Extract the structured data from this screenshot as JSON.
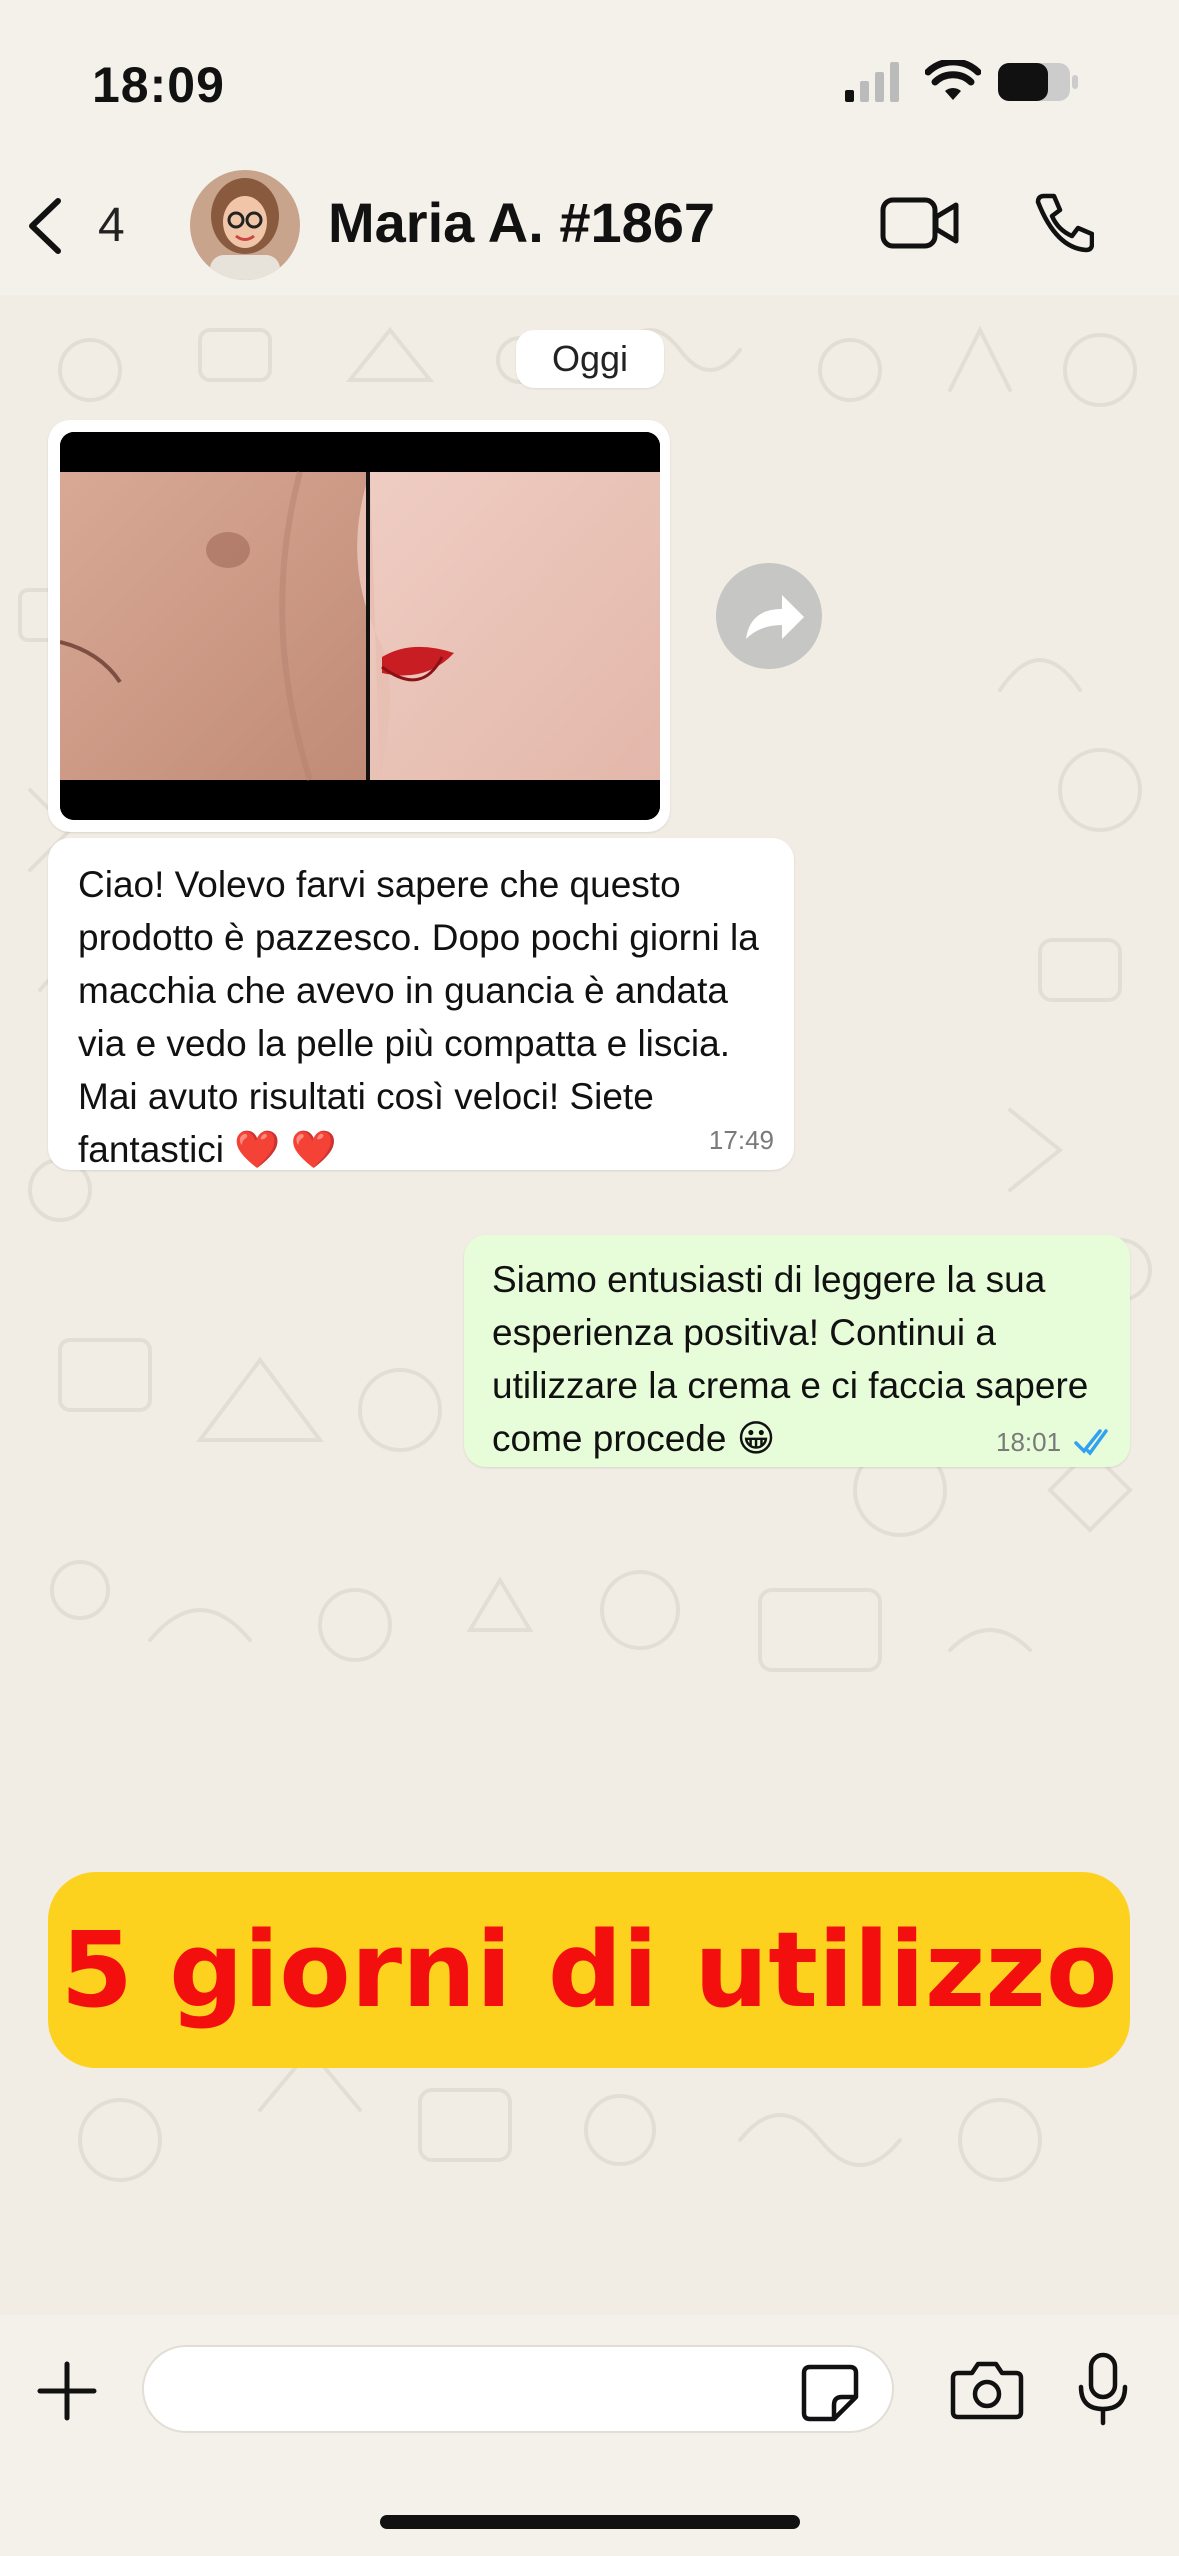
{
  "status_bar": {
    "time": "18:09"
  },
  "header": {
    "back_count": "4",
    "contact_name": "Maria A. #1867"
  },
  "chat": {
    "date_label": "Oggi",
    "incoming": {
      "text": "Ciao! Volevo farvi sapere che questo prodotto è pazzesco. Dopo pochi giorni la macchia che avevo in guancia è andata via e vedo la pelle più compatta e liscia. Mai avuto risultati così veloci! Siete fantastici",
      "hearts": "❤️ ❤️",
      "time": "17:49"
    },
    "outgoing": {
      "text": "Siamo entusiasti di leggere la sua esperienza positiva! Continui a utilizzare la crema e ci faccia sapere come procede",
      "emoji": "😀",
      "time": "18:01"
    }
  },
  "banner": {
    "text": "5 giorni di utilizzo"
  },
  "input": {
    "placeholder": ""
  },
  "colors": {
    "background": "#f1ede4",
    "outgoing_bubble": "#e7fcd8",
    "banner_bg": "#fdd21f",
    "banner_text": "#f40f0f",
    "read_ticks": "#34a0f0"
  }
}
